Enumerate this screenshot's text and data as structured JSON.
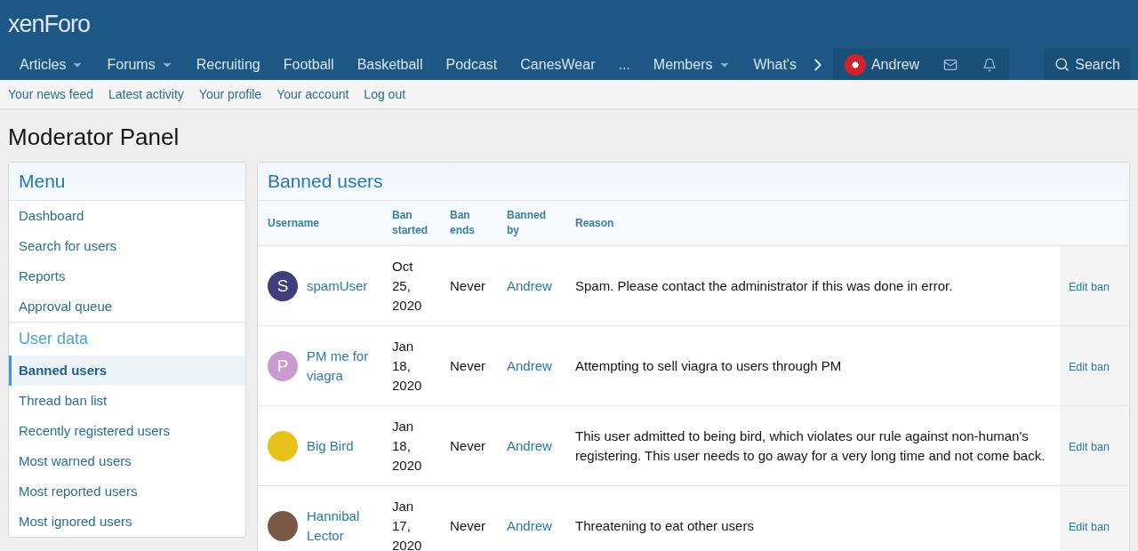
{
  "logo": "xenForo",
  "nav": [
    {
      "label": "Articles",
      "dropdown": true
    },
    {
      "label": "Forums",
      "dropdown": true
    },
    {
      "label": "Recruiting",
      "dropdown": false
    },
    {
      "label": "Football",
      "dropdown": false
    },
    {
      "label": "Basketball",
      "dropdown": false
    },
    {
      "label": "Podcast",
      "dropdown": false
    },
    {
      "label": "CanesWear",
      "dropdown": false
    },
    {
      "label": "...",
      "dropdown": false
    },
    {
      "label": "Members",
      "dropdown": true
    },
    {
      "label": "What's",
      "dropdown": false
    }
  ],
  "user": {
    "name": "Andrew"
  },
  "search": {
    "label": "Search"
  },
  "subnav": [
    "Your news feed",
    "Latest activity",
    "Your profile",
    "Your account",
    "Log out"
  ],
  "page_title": "Moderator Panel",
  "sidebar": {
    "title": "Menu",
    "sections": [
      {
        "items": [
          {
            "label": "Dashboard",
            "selected": false
          },
          {
            "label": "Search for users",
            "selected": false
          },
          {
            "label": "Reports",
            "selected": false
          },
          {
            "label": "Approval queue",
            "selected": false
          }
        ]
      },
      {
        "heading": "User data",
        "items": [
          {
            "label": "Banned users",
            "selected": true
          },
          {
            "label": "Thread ban list",
            "selected": false
          },
          {
            "label": "Recently registered users",
            "selected": false
          },
          {
            "label": "Most warned users",
            "selected": false
          },
          {
            "label": "Most reported users",
            "selected": false
          },
          {
            "label": "Most ignored users",
            "selected": false
          }
        ]
      }
    ]
  },
  "table": {
    "title": "Banned users",
    "columns": [
      "Username",
      "Ban started",
      "Ban ends",
      "Banned by",
      "Reason"
    ],
    "rows": [
      {
        "avatar": {
          "kind": "letter",
          "letter": "S",
          "color": "#3d3f7c"
        },
        "username": "spamUser",
        "started": "Oct 25, 2020",
        "ends": "Never",
        "by": "Andrew",
        "reason": "Spam. Please contact the administrator if this was done in error.",
        "action": "Edit ban"
      },
      {
        "avatar": {
          "kind": "letter",
          "letter": "P",
          "color": "#c99bcf"
        },
        "username": "PM me for viagra",
        "started": "Jan 18, 2020",
        "ends": "Never",
        "by": "Andrew",
        "reason": "Attempting to sell viagra to users through PM",
        "action": "Edit ban"
      },
      {
        "avatar": {
          "kind": "photo",
          "color": "#e8c21a"
        },
        "username": "Big Bird",
        "started": "Jan 18, 2020",
        "ends": "Never",
        "by": "Andrew",
        "reason": "This user admitted to being bird, which violates our rule against non-human's registering. This user needs to go away for a very long time and not come back.",
        "action": "Edit ban"
      },
      {
        "avatar": {
          "kind": "photo",
          "color": "#7a5a45"
        },
        "username": "Hannibal Lector",
        "started": "Jan 17, 2020",
        "ends": "Never",
        "by": "Andrew",
        "reason": "Threatening to eat other users",
        "action": "Edit ban"
      }
    ]
  }
}
